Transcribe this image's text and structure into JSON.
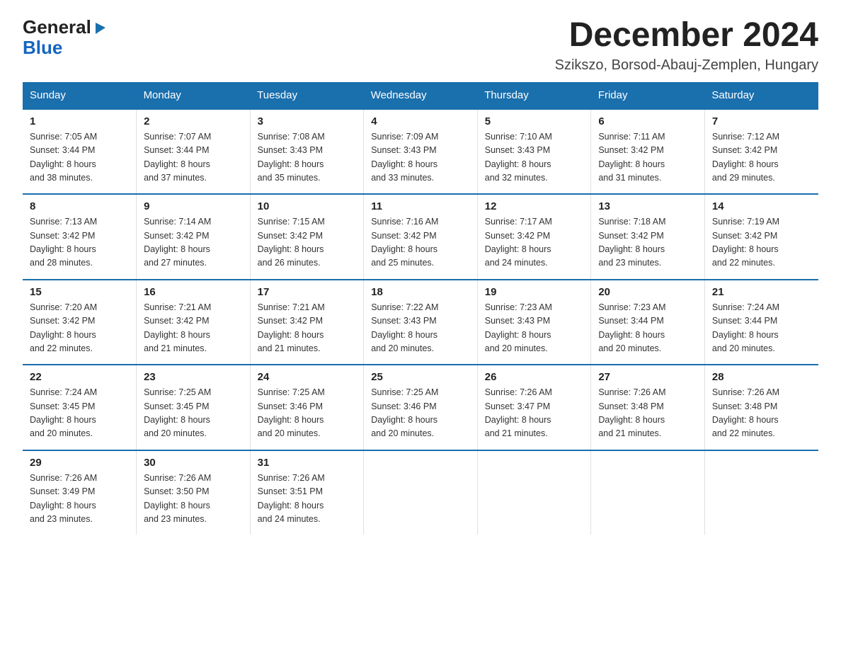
{
  "logo": {
    "general": "General",
    "blue": "Blue",
    "triangle": "▶"
  },
  "title": "December 2024",
  "subtitle": "Szikszo, Borsod-Abauj-Zemplen, Hungary",
  "weekdays": [
    "Sunday",
    "Monday",
    "Tuesday",
    "Wednesday",
    "Thursday",
    "Friday",
    "Saturday"
  ],
  "weeks": [
    [
      {
        "day": "1",
        "sunrise": "7:05 AM",
        "sunset": "3:44 PM",
        "daylight": "8 hours and 38 minutes."
      },
      {
        "day": "2",
        "sunrise": "7:07 AM",
        "sunset": "3:44 PM",
        "daylight": "8 hours and 37 minutes."
      },
      {
        "day": "3",
        "sunrise": "7:08 AM",
        "sunset": "3:43 PM",
        "daylight": "8 hours and 35 minutes."
      },
      {
        "day": "4",
        "sunrise": "7:09 AM",
        "sunset": "3:43 PM",
        "daylight": "8 hours and 33 minutes."
      },
      {
        "day": "5",
        "sunrise": "7:10 AM",
        "sunset": "3:43 PM",
        "daylight": "8 hours and 32 minutes."
      },
      {
        "day": "6",
        "sunrise": "7:11 AM",
        "sunset": "3:42 PM",
        "daylight": "8 hours and 31 minutes."
      },
      {
        "day": "7",
        "sunrise": "7:12 AM",
        "sunset": "3:42 PM",
        "daylight": "8 hours and 29 minutes."
      }
    ],
    [
      {
        "day": "8",
        "sunrise": "7:13 AM",
        "sunset": "3:42 PM",
        "daylight": "8 hours and 28 minutes."
      },
      {
        "day": "9",
        "sunrise": "7:14 AM",
        "sunset": "3:42 PM",
        "daylight": "8 hours and 27 minutes."
      },
      {
        "day": "10",
        "sunrise": "7:15 AM",
        "sunset": "3:42 PM",
        "daylight": "8 hours and 26 minutes."
      },
      {
        "day": "11",
        "sunrise": "7:16 AM",
        "sunset": "3:42 PM",
        "daylight": "8 hours and 25 minutes."
      },
      {
        "day": "12",
        "sunrise": "7:17 AM",
        "sunset": "3:42 PM",
        "daylight": "8 hours and 24 minutes."
      },
      {
        "day": "13",
        "sunrise": "7:18 AM",
        "sunset": "3:42 PM",
        "daylight": "8 hours and 23 minutes."
      },
      {
        "day": "14",
        "sunrise": "7:19 AM",
        "sunset": "3:42 PM",
        "daylight": "8 hours and 22 minutes."
      }
    ],
    [
      {
        "day": "15",
        "sunrise": "7:20 AM",
        "sunset": "3:42 PM",
        "daylight": "8 hours and 22 minutes."
      },
      {
        "day": "16",
        "sunrise": "7:21 AM",
        "sunset": "3:42 PM",
        "daylight": "8 hours and 21 minutes."
      },
      {
        "day": "17",
        "sunrise": "7:21 AM",
        "sunset": "3:42 PM",
        "daylight": "8 hours and 21 minutes."
      },
      {
        "day": "18",
        "sunrise": "7:22 AM",
        "sunset": "3:43 PM",
        "daylight": "8 hours and 20 minutes."
      },
      {
        "day": "19",
        "sunrise": "7:23 AM",
        "sunset": "3:43 PM",
        "daylight": "8 hours and 20 minutes."
      },
      {
        "day": "20",
        "sunrise": "7:23 AM",
        "sunset": "3:44 PM",
        "daylight": "8 hours and 20 minutes."
      },
      {
        "day": "21",
        "sunrise": "7:24 AM",
        "sunset": "3:44 PM",
        "daylight": "8 hours and 20 minutes."
      }
    ],
    [
      {
        "day": "22",
        "sunrise": "7:24 AM",
        "sunset": "3:45 PM",
        "daylight": "8 hours and 20 minutes."
      },
      {
        "day": "23",
        "sunrise": "7:25 AM",
        "sunset": "3:45 PM",
        "daylight": "8 hours and 20 minutes."
      },
      {
        "day": "24",
        "sunrise": "7:25 AM",
        "sunset": "3:46 PM",
        "daylight": "8 hours and 20 minutes."
      },
      {
        "day": "25",
        "sunrise": "7:25 AM",
        "sunset": "3:46 PM",
        "daylight": "8 hours and 20 minutes."
      },
      {
        "day": "26",
        "sunrise": "7:26 AM",
        "sunset": "3:47 PM",
        "daylight": "8 hours and 21 minutes."
      },
      {
        "day": "27",
        "sunrise": "7:26 AM",
        "sunset": "3:48 PM",
        "daylight": "8 hours and 21 minutes."
      },
      {
        "day": "28",
        "sunrise": "7:26 AM",
        "sunset": "3:48 PM",
        "daylight": "8 hours and 22 minutes."
      }
    ],
    [
      {
        "day": "29",
        "sunrise": "7:26 AM",
        "sunset": "3:49 PM",
        "daylight": "8 hours and 23 minutes."
      },
      {
        "day": "30",
        "sunrise": "7:26 AM",
        "sunset": "3:50 PM",
        "daylight": "8 hours and 23 minutes."
      },
      {
        "day": "31",
        "sunrise": "7:26 AM",
        "sunset": "3:51 PM",
        "daylight": "8 hours and 24 minutes."
      },
      null,
      null,
      null,
      null
    ]
  ],
  "labels": {
    "sunrise_prefix": "Sunrise: ",
    "sunset_prefix": "Sunset: ",
    "daylight_prefix": "Daylight: "
  }
}
